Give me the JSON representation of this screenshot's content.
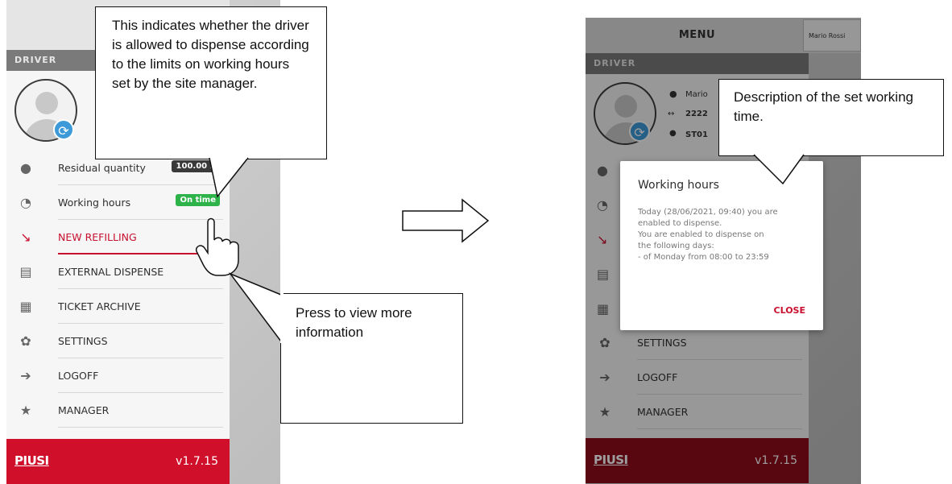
{
  "left_screen": {
    "section_label": "DRIVER",
    "residual_quantity": {
      "label": "Residual quantity",
      "value": "100.00 L"
    },
    "working_hours": {
      "label": "Working hours",
      "status": "On time"
    },
    "menu": [
      {
        "label": "NEW REFILLING",
        "icon": "fuel-nozzle-icon"
      },
      {
        "label": "EXTERNAL DISPENSE",
        "icon": "fuel-pump-icon"
      },
      {
        "label": "TICKET ARCHIVE",
        "icon": "receipt-icon"
      },
      {
        "label": "SETTINGS",
        "icon": "gear-icon"
      },
      {
        "label": "LOGOFF",
        "icon": "logout-icon"
      },
      {
        "label": "MANAGER",
        "icon": "star-icon"
      }
    ],
    "brand": "PIUSI",
    "version": "v1.7.15"
  },
  "callouts": {
    "driver_allowed": "This indicates whether the driver is allowed to dispense according to the limits on working hours set by the site manager.",
    "press_more": "Press to view more information",
    "description": "Description of the set working time."
  },
  "right_screen": {
    "title": "MENU",
    "user_name": "Mario Rossi",
    "section_label": "DRIVER",
    "driver_info": {
      "name": "Mario",
      "code": "2222",
      "station": "ST01"
    },
    "menu": [
      {
        "label": "SETTINGS",
        "icon": "gear-icon"
      },
      {
        "label": "LOGOFF",
        "icon": "logout-icon"
      },
      {
        "label": "MANAGER",
        "icon": "star-icon"
      }
    ],
    "brand": "PIUSI",
    "version": "v1.7.15",
    "dialog": {
      "title": "Working hours",
      "body": [
        "Today (28/06/2021, 09:40) you are",
        "enabled to dispense.",
        "You are enabled to dispense on",
        "the following days:",
        "- of Monday from 08:00 to 23:59"
      ],
      "close": "CLOSE"
    }
  },
  "colors": {
    "brand_red": "#d0102b",
    "status_green": "#2db34a",
    "accent_blue": "#3d9ad8"
  }
}
